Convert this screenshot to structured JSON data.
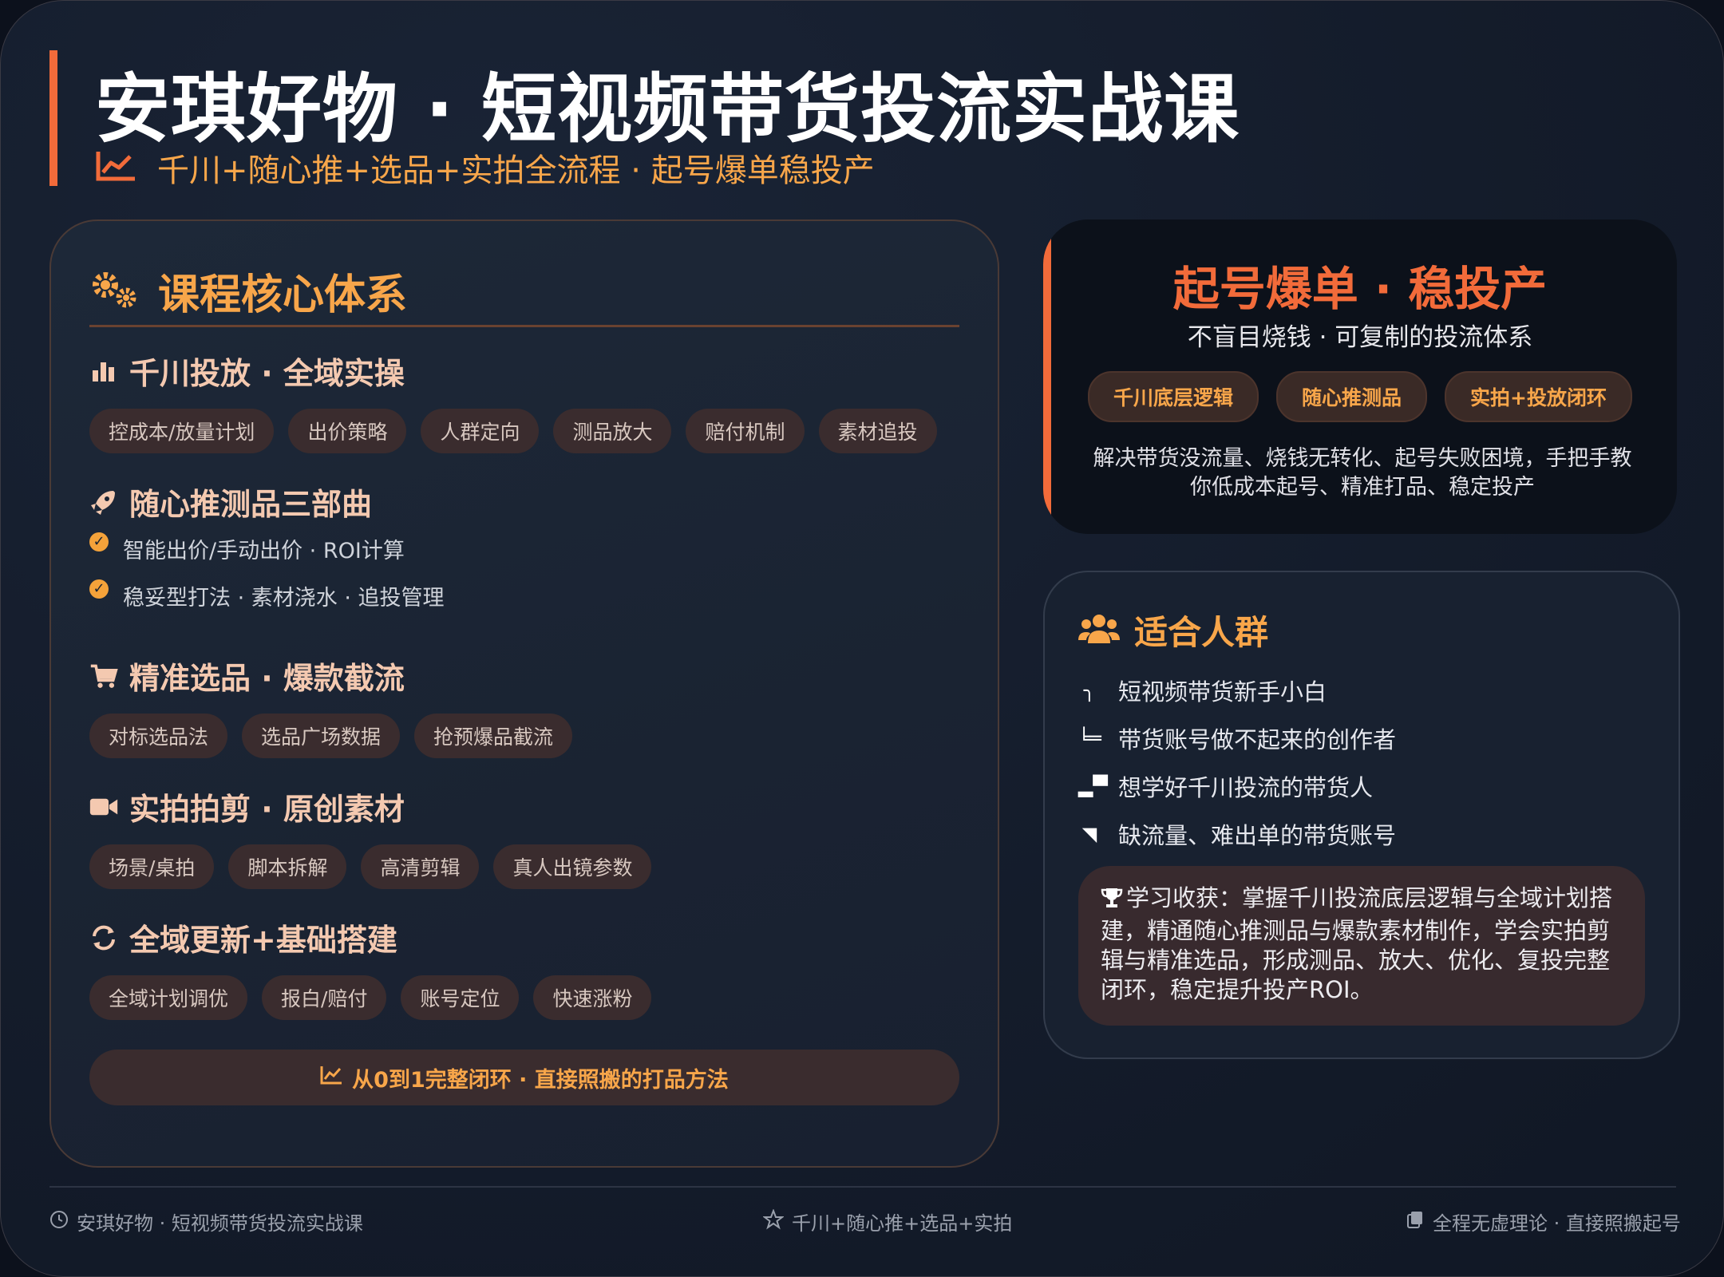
{
  "header": {
    "title": "安琪好物 · 短视频带货投流实战课",
    "subtitle": "千川+随心推+选品+实拍全流程 · 起号爆单稳投产",
    "subtitle_icon": "trend-chart-icon"
  },
  "core": {
    "title": "课程核心体系",
    "title_icon": "gears-icon",
    "sections": [
      {
        "title": "千川投放 · 全域实操",
        "icon": "bar-chart-icon",
        "chips": [
          "控成本/放量计划",
          "出价策略",
          "人群定向",
          "测品放大",
          "赔付机制",
          "素材追投"
        ]
      },
      {
        "title": "随心推测品三部曲",
        "icon": "rocket-icon",
        "bullets": [
          "智能出价/手动出价 · ROI计算",
          "稳妥型打法 · 素材浇水 · 追投管理"
        ]
      },
      {
        "title": "精准选品 · 爆款截流",
        "icon": "cart-icon",
        "chips": [
          "对标选品法",
          "选品广场数据",
          "抢预爆品截流"
        ]
      },
      {
        "title": "实拍拍剪 · 原创素材",
        "icon": "video-camera-icon",
        "chips": [
          "场景/桌拍",
          "脚本拆解",
          "高清剪辑",
          "真人出镜参数"
        ]
      },
      {
        "title": "全域更新+基础搭建",
        "icon": "refresh-icon",
        "chips": [
          "全域计划调优",
          "报白/赔付",
          "账号定位",
          "快速涨粉"
        ]
      }
    ],
    "bottom_bar": "从0到1完整闭环 · 直接照搬的打品方法"
  },
  "highlight": {
    "title": "起号爆单 · 稳投产",
    "subtitle": "不盲目烧钱 · 可复制的投流体系",
    "badges": [
      "千川底层逻辑",
      "随心推测品",
      "实拍+投放闭环"
    ],
    "description": "解决带货没流量、烧钱无转化、起号失败困境，手把手教你低成本起号、精准打品、稳定投产"
  },
  "audience": {
    "title": "适合人群",
    "icon": "users-icon",
    "items": [
      {
        "mark": "╮",
        "text": "短视频带货新手小白"
      },
      {
        "mark": "╘═",
        "text": "带货账号做不起来的创作者"
      },
      {
        "mark": "▂▀",
        "text": "想学好千川投流的带货人"
      },
      {
        "mark": "◥",
        "text": "缺流量、难出单的带货账号"
      }
    ],
    "gain": "学习收获：掌握千川投流底层逻辑与全域计划搭建，精通随心推测品与爆款素材制作，学会实拍剪辑与精准选品，形成测品、放大、优化、复投完整闭环，稳定提升投产ROI。",
    "gain_icon": "trophy-icon"
  },
  "footer": {
    "left": "安琪好物 · 短视频带货投流实战课",
    "center": "千川+随心推+选品+实拍",
    "right": "全程无虚理论 · 直接照搬起号"
  },
  "colors": {
    "accent": "#f26b3a",
    "highlight": "#f8a64a",
    "background": "#141c2b"
  }
}
